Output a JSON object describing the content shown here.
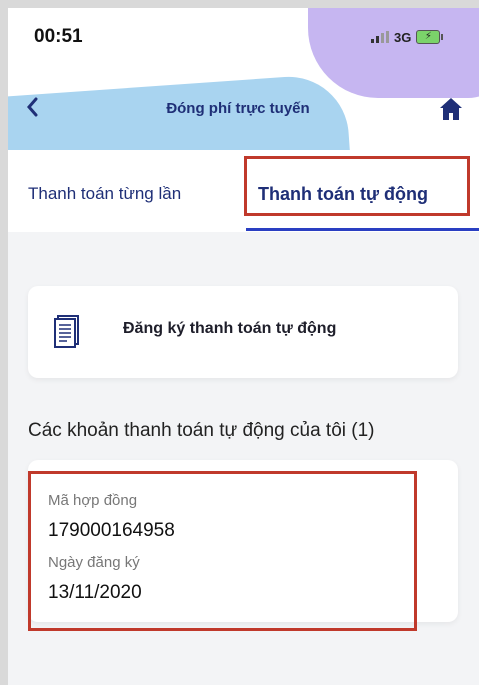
{
  "status": {
    "time": "00:51",
    "network": "3G"
  },
  "header": {
    "title": "Đóng phí trực tuyến"
  },
  "tabs": [
    {
      "label": "Thanh toán từng lần"
    },
    {
      "label": "Thanh toán tự động"
    }
  ],
  "register": {
    "label": "Đăng ký thanh toán tự động"
  },
  "section": {
    "title": "Các khoản thanh toán tự động của tôi (1)"
  },
  "contract": {
    "contract_label": "Mã hợp đồng",
    "contract_value": "179000164958",
    "date_label": "Ngày đăng ký",
    "date_value": "13/11/2020"
  },
  "colors": {
    "primary": "#1f2f77",
    "tab_underline": "#2a3fc2",
    "highlight": "#c0392b",
    "blob_purple": "#c6b6f1",
    "blob_blue": "#a9d4f0"
  },
  "icons": [
    "back-arrow-icon",
    "home-icon",
    "document-icon",
    "signal-icon",
    "battery-icon"
  ]
}
